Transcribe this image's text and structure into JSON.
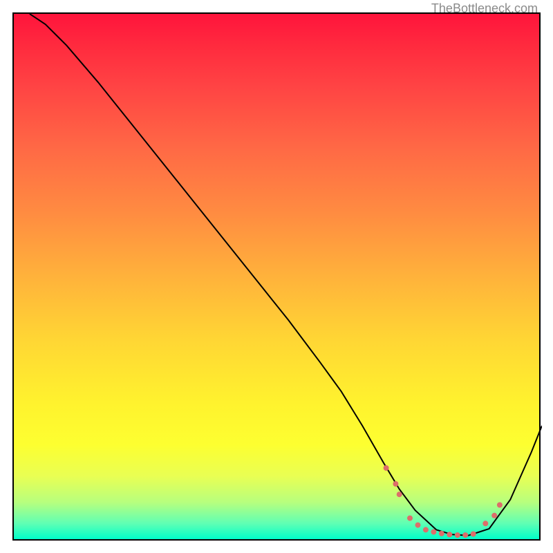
{
  "attribution": "TheBottleneck.com",
  "chart_data": {
    "type": "line",
    "title": "",
    "xlabel": "",
    "ylabel": "",
    "xlim": [
      0,
      100
    ],
    "ylim": [
      0,
      100
    ],
    "axes_visible": false,
    "background": "gradient_red_to_green",
    "series": [
      {
        "name": "bottleneck-curve",
        "color": "#000000",
        "x": [
          3,
          6,
          10,
          16,
          22,
          28,
          34,
          40,
          46,
          52,
          58,
          62,
          66,
          70,
          73,
          76,
          80,
          83,
          86,
          90,
          94,
          98,
          100
        ],
        "y": [
          100,
          98,
          94,
          87,
          79.5,
          72,
          64.5,
          57,
          49.5,
          42,
          34,
          28.5,
          22,
          15,
          10,
          6,
          2.3,
          1.4,
          1.2,
          2.5,
          8,
          17,
          22
        ]
      }
    ],
    "markers": {
      "name": "highlight-points",
      "color": "#dc6e6a",
      "radius": 4,
      "points": [
        {
          "x": 70.5,
          "y": 14
        },
        {
          "x": 72.3,
          "y": 11
        },
        {
          "x": 73.0,
          "y": 9
        },
        {
          "x": 75.0,
          "y": 4.5
        },
        {
          "x": 76.5,
          "y": 3.2
        },
        {
          "x": 78.0,
          "y": 2.3
        },
        {
          "x": 79.5,
          "y": 1.9
        },
        {
          "x": 81.0,
          "y": 1.6
        },
        {
          "x": 82.5,
          "y": 1.4
        },
        {
          "x": 84.0,
          "y": 1.3
        },
        {
          "x": 85.5,
          "y": 1.3
        },
        {
          "x": 87.0,
          "y": 1.5
        },
        {
          "x": 89.3,
          "y": 3.5
        },
        {
          "x": 91.0,
          "y": 5.0
        },
        {
          "x": 92.0,
          "y": 7.0
        }
      ]
    }
  }
}
